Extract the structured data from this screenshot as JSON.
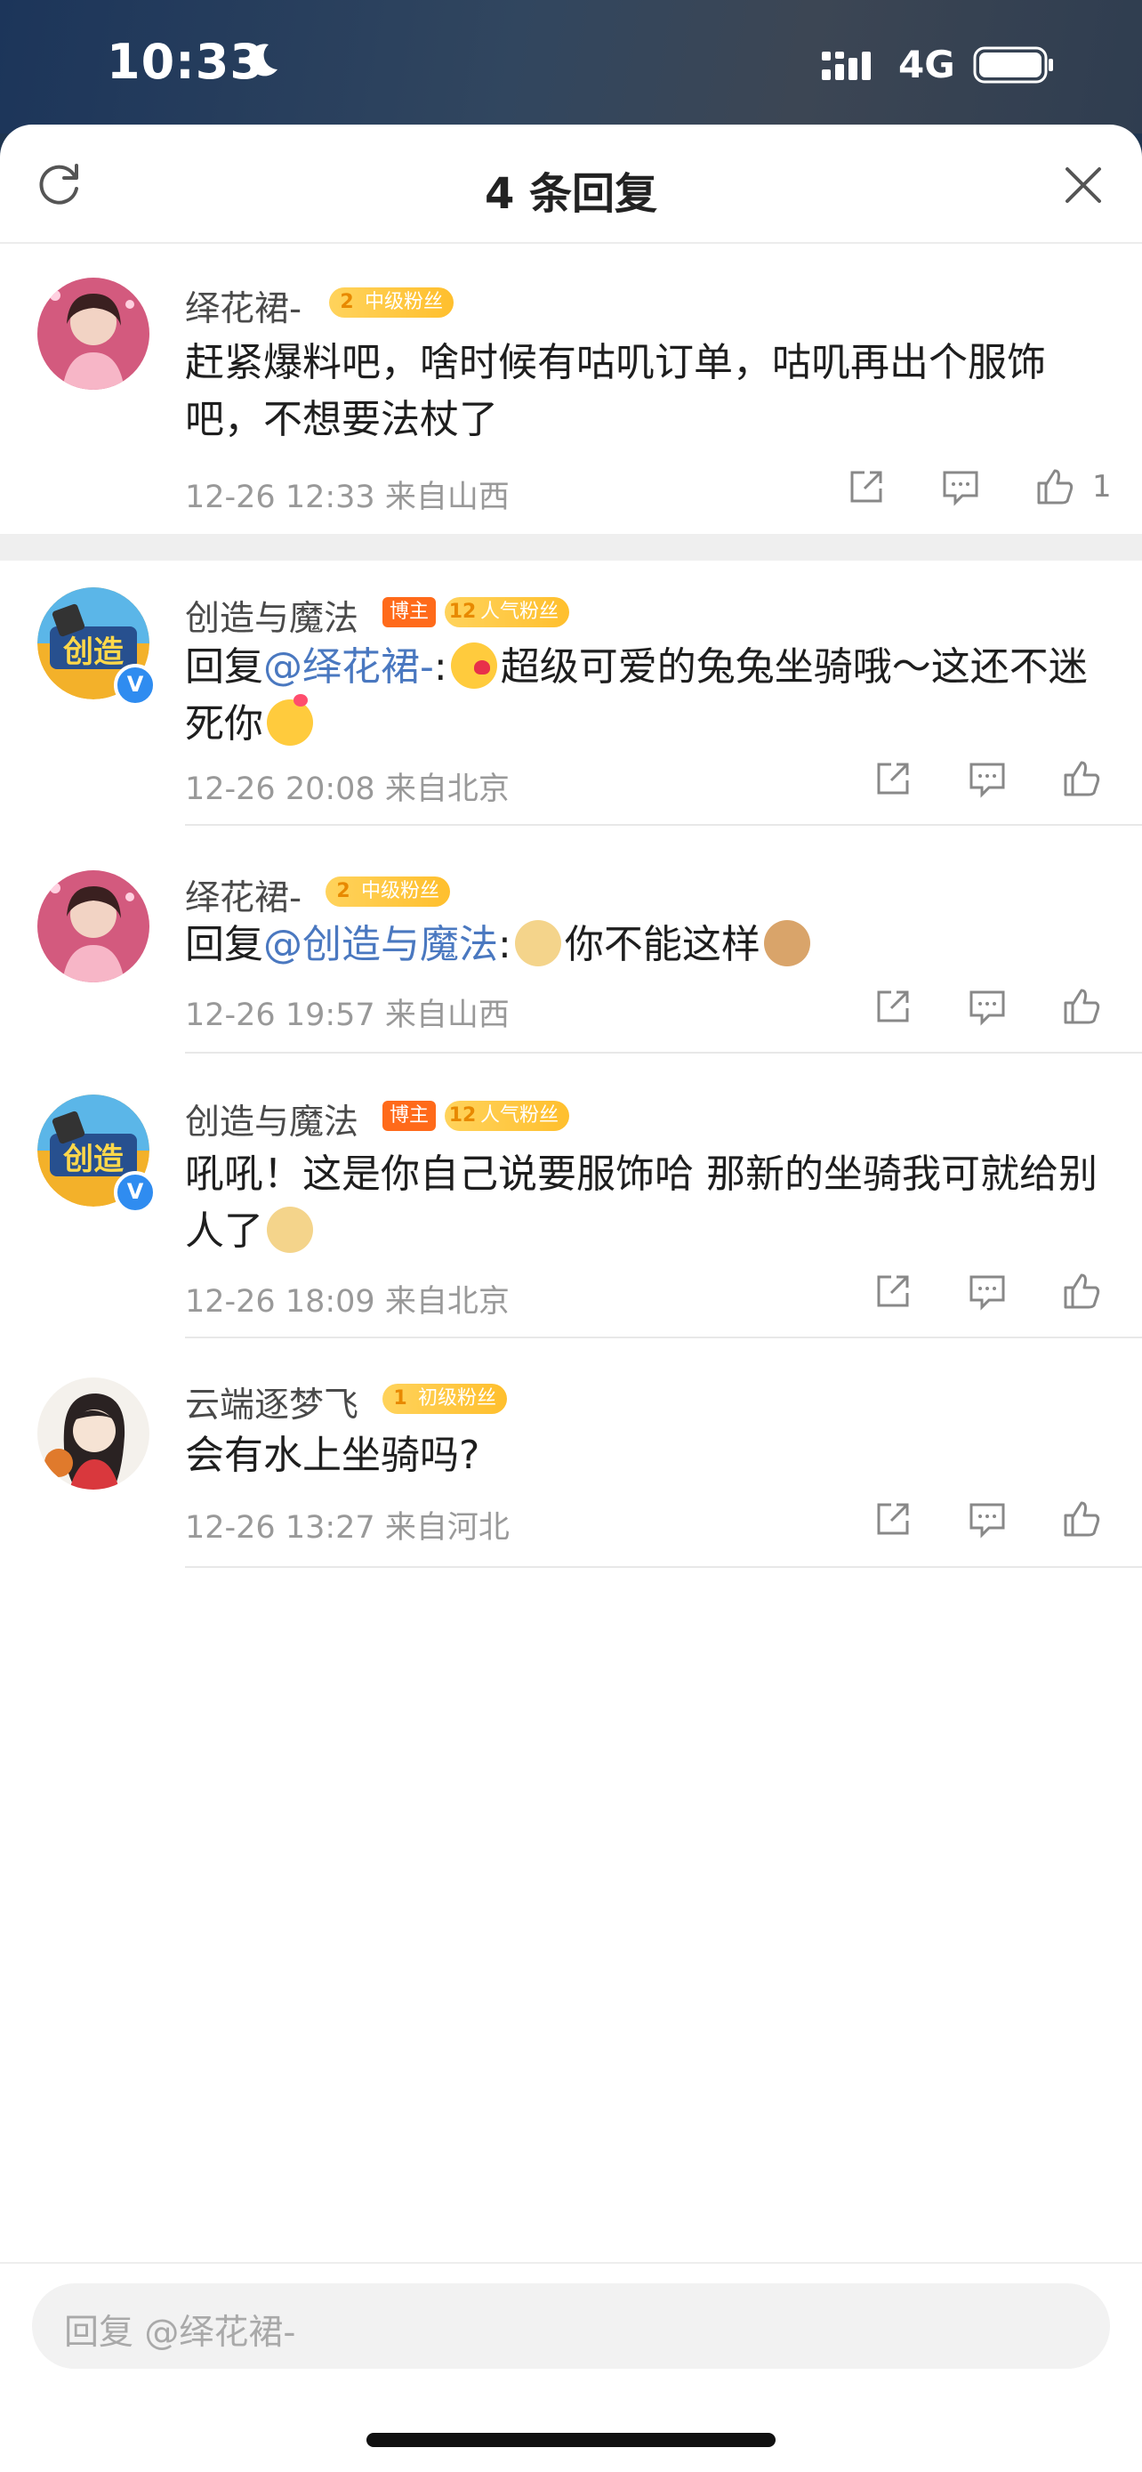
{
  "status_bar": {
    "time": "10:33",
    "network": "4G"
  },
  "header": {
    "title": "4 条回复"
  },
  "comments": [
    {
      "name": "绎花裙-",
      "fan_badge": {
        "level": "2",
        "label": "中级粉丝"
      },
      "text": "赶紧爆料吧，啥时候有咕叽订单，咕叽再出个服饰吧，不想要法杖了",
      "meta": "12-26 12:33  来自山西",
      "likes": "1"
    },
    {
      "name": "创造与魔法",
      "host_badge": "博主",
      "fan_badge": {
        "level": "12",
        "label": "人气粉丝"
      },
      "reply_prefix": "回复",
      "mention": "@绎花裙-",
      "text_after": ":",
      "text_main": "超级可爱的兔兔坐骑哦～这还不迷死你",
      "meta": "12-26 20:08  来自北京"
    },
    {
      "name": "绎花裙-",
      "fan_badge": {
        "level": "2",
        "label": "中级粉丝"
      },
      "reply_prefix": "回复",
      "mention": "@创造与魔法",
      "text_after": ":",
      "text_main": "你不能这样",
      "meta": "12-26 19:57  来自山西"
    },
    {
      "name": "创造与魔法",
      "host_badge": "博主",
      "fan_badge": {
        "level": "12",
        "label": "人气粉丝"
      },
      "text": "吼吼！这是你自己说要服饰哈 那新的坐骑我可就给别人了",
      "meta": "12-26 18:09  来自北京"
    },
    {
      "name": "云端逐梦飞",
      "fan_badge": {
        "level": "1",
        "label": "初级粉丝"
      },
      "text": "会有水上坐骑吗?",
      "meta": "12-26 13:27  来自河北"
    }
  ],
  "reply_bar": {
    "placeholder": "回复 @绎花裙-"
  }
}
